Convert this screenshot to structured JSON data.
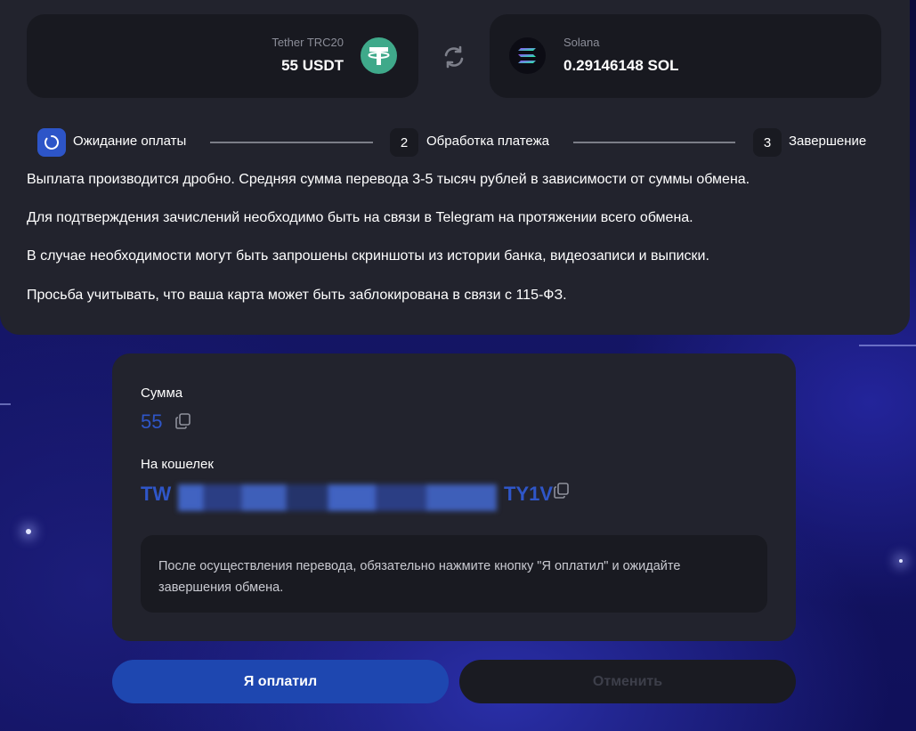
{
  "exchange": {
    "from": {
      "name": "Tether TRC20",
      "amount": "55 USDT",
      "icon": "tether-icon",
      "color": "#3fa98a"
    },
    "to": {
      "name": "Solana",
      "amount": "0.29146148 SOL",
      "icon": "solana-icon"
    },
    "swap_icon": "refresh-icon"
  },
  "steps": [
    {
      "number": "",
      "label": "Ожидание оплаты",
      "state": "active"
    },
    {
      "number": "2",
      "label": "Обработка платежа",
      "state": "pending"
    },
    {
      "number": "3",
      "label": "Завершение",
      "state": "pending"
    }
  ],
  "info": [
    "Выплата производится дробно. Средняя сумма перевода 3-5 тысяч рублей в зависимости от суммы обмена.",
    "Для подтверждения зачислений необходимо быть на связи в Telegram на протяжении всего обмена.",
    "В случае необходимости могут быть запрошены скриншоты из истории банка, видеозаписи и выписки.",
    "Просьба учитывать, что ваша карта может быть заблокирована в связи с 115-ФЗ."
  ],
  "payment": {
    "amount_label": "Сумма",
    "amount_value": "55",
    "wallet_label": "На кошелек",
    "wallet_prefix": "TW",
    "wallet_suffix": "TY1V",
    "notice": "После осуществления перевода, обязательно нажмите кнопку \"Я оплатил\" и ожидайте завершения обмена."
  },
  "buttons": {
    "paid": "Я оплатил",
    "cancel": "Отменить"
  },
  "colors": {
    "accent": "#2d55c8",
    "card": "#22232d",
    "inner": "#181920"
  }
}
